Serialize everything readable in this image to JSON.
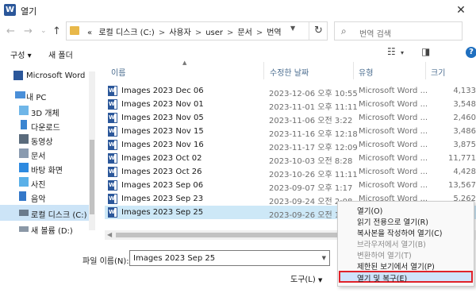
{
  "window": {
    "title": "열기",
    "close": "✕"
  },
  "nav_buttons": {
    "back": "←",
    "forward": "→",
    "recent": "⌄",
    "up": "↑"
  },
  "address": {
    "prefix": "«",
    "crumbs": [
      "로컬 디스크 (C:)",
      "사용자",
      "user",
      "문서",
      "번역"
    ]
  },
  "search": {
    "placeholder": "번역 검색"
  },
  "toolbar": {
    "organize": "구성 ▾",
    "new_folder": "새 폴더"
  },
  "nav_pane": {
    "items": [
      {
        "label": "Microsoft Word",
        "icon": "word-icon"
      },
      {
        "label": "내 PC",
        "icon": "pc-icon"
      },
      {
        "label": "3D 개체",
        "icon": "3d-objects-icon"
      },
      {
        "label": "다운로드",
        "icon": "download-icon"
      },
      {
        "label": "동영상",
        "icon": "video-icon"
      },
      {
        "label": "문서",
        "icon": "document-icon"
      },
      {
        "label": "바탕 화면",
        "icon": "desktop-icon"
      },
      {
        "label": "사진",
        "icon": "picture-icon"
      },
      {
        "label": "음악",
        "icon": "music-icon"
      },
      {
        "label": "로컬 디스크 (C:)",
        "icon": "drive-icon"
      },
      {
        "label": "새 볼륨 (D:)",
        "icon": "drive-icon"
      }
    ]
  },
  "columns": {
    "name": "이름",
    "date": "수정한 날짜",
    "type": "유형",
    "size": "크기"
  },
  "files": [
    {
      "name": "Images 2023 Dec 06",
      "date": "2023-12-06 오후 10:55",
      "type": "Microsoft Word ...",
      "size": "4,133"
    },
    {
      "name": "Images 2023 Nov 01",
      "date": "2023-11-01 오후 11:11",
      "type": "Microsoft Word ...",
      "size": "3,548"
    },
    {
      "name": "Images 2023 Nov 05",
      "date": "2023-11-06 오전 3:22",
      "type": "Microsoft Word ...",
      "size": "2,460"
    },
    {
      "name": "Images 2023 Nov 15",
      "date": "2023-11-16 오후 12:18",
      "type": "Microsoft Word ...",
      "size": "3,486"
    },
    {
      "name": "Images 2023 Nov 16",
      "date": "2023-11-17 오후 12:09",
      "type": "Microsoft Word ...",
      "size": "3,875"
    },
    {
      "name": "Images 2023 Oct 02",
      "date": "2023-10-03 오전 8:28",
      "type": "Microsoft Word ...",
      "size": "11,771"
    },
    {
      "name": "Images 2023 Oct 26",
      "date": "2023-10-26 오후 11:11",
      "type": "Microsoft Word ...",
      "size": "4,428"
    },
    {
      "name": "Images 2023 Sep 06",
      "date": "2023-09-07 오후 1:17",
      "type": "Microsoft Word ...",
      "size": "13,567"
    },
    {
      "name": "Images 2023 Sep 23",
      "date": "2023-09-24 오전 2:08",
      "type": "Microsoft Word ...",
      "size": "5,262"
    },
    {
      "name": "Images 2023 Sep 25",
      "date": "2023-09-26 오전 12:4",
      "type": "",
      "size": ""
    }
  ],
  "filename": {
    "label": "파일 이름(N):",
    "value": "Images 2023 Sep 25"
  },
  "tools": {
    "label": "도구(L)"
  },
  "menu": {
    "items": [
      {
        "label": "열기(O)",
        "disabled": false
      },
      {
        "label": "읽기 전용으로 열기(R)",
        "disabled": false
      },
      {
        "label": "복사본을 작성하여 열기(C)",
        "disabled": false
      },
      {
        "label": "브라우저에서 열기(B)",
        "disabled": true
      },
      {
        "label": "변환하여 열기(T)",
        "disabled": true
      },
      {
        "label": "제한된 보기에서 열기(P)",
        "disabled": false
      },
      {
        "label": "열기 및 복구(E)",
        "disabled": false
      }
    ]
  },
  "colors": {
    "accent": "#2b579a",
    "selection": "#cce4f7",
    "highlight_border": "#e0222a"
  }
}
